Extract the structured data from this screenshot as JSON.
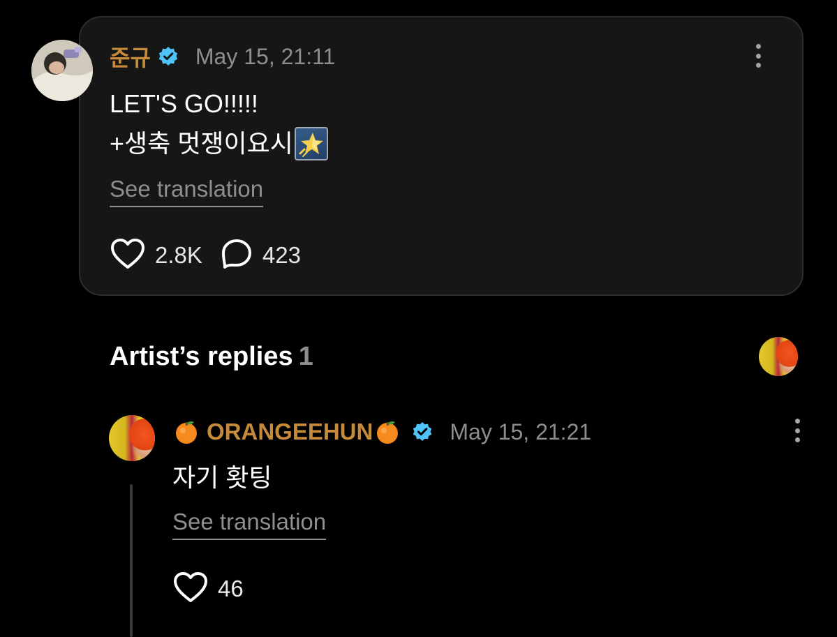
{
  "post": {
    "author": "준규",
    "verified_icon": "verified-badge-icon",
    "timestamp": "May 15, 21:11",
    "body_line1": "LET'S GO!!!!!",
    "body_line2": "+생축 멋쟁이요시",
    "body_emoji": "glowing-star-icon",
    "see_translation": "See translation",
    "likes": "2.8K",
    "comments": "423"
  },
  "replies": {
    "title": "Artist’s replies",
    "count": "1"
  },
  "reply": {
    "author": "ORANGEEHUN",
    "name_emoji": "orange-icon",
    "verified_icon": "verified-badge-icon",
    "timestamp": "May 15, 21:21",
    "body": "자기 홧팅",
    "see_translation": "See translation",
    "likes": "46"
  },
  "colors": {
    "background": "#000000",
    "card": "#161616",
    "card_border": "#2d2d2d",
    "author_name": "#c58b3b",
    "muted_text": "#8e8e8e",
    "verified": "#4fc3f7"
  }
}
